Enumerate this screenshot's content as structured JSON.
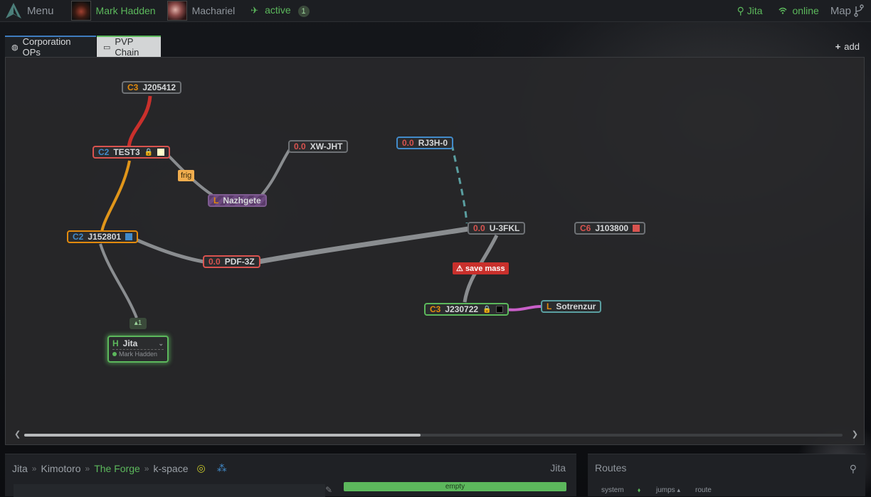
{
  "navbar": {
    "menu_label": "Menu",
    "characters": [
      {
        "name": "Mark Hadden",
        "active": true
      },
      {
        "name": "Machariel",
        "active": false
      }
    ],
    "status_label": "active",
    "status_count": "1",
    "location": "Jita",
    "connection": "online",
    "map_label": "Map"
  },
  "tabs": [
    {
      "label": "Corporation OPs",
      "icon": "globe-icon"
    },
    {
      "label": "PVP Chain",
      "icon": "desktop-icon"
    }
  ],
  "add_label": "add",
  "systems": [
    {
      "id": "j205412",
      "class": "C3",
      "name": "J205412",
      "class_color": "#e28a0d"
    },
    {
      "id": "test3",
      "class": "C2",
      "name": "TEST3",
      "class_color": "#428bca",
      "locked": true,
      "marker": "#ffffcc"
    },
    {
      "id": "xwjht",
      "class": "0.0",
      "name": "XW-JHT",
      "class_color": "#d9534f"
    },
    {
      "id": "nazhgete",
      "class": "L",
      "name": "Nazhgete",
      "class_color": "#e28a0d"
    },
    {
      "id": "rj3h0",
      "class": "0.0",
      "name": "RJ3H-0",
      "class_color": "#d9534f"
    },
    {
      "id": "j152801",
      "class": "C2",
      "name": "J152801",
      "class_color": "#428bca",
      "marker": "#428bca"
    },
    {
      "id": "pdf3z",
      "class": "0.0",
      "name": "PDF-3Z",
      "class_color": "#d9534f"
    },
    {
      "id": "u3fkl",
      "class": "0.0",
      "name": "U-3FKL",
      "class_color": "#d9534f"
    },
    {
      "id": "j103800",
      "class": "C6",
      "name": "J103800",
      "class_color": "#d9534f",
      "marker": "#d9534f"
    },
    {
      "id": "j230722",
      "class": "C3",
      "name": "J230722",
      "class_color": "#e28a0d",
      "locked": true,
      "marker": "#000000"
    },
    {
      "id": "sotrenzur",
      "class": "L",
      "name": "Sotrenzur",
      "class_color": "#e28a0d"
    }
  ],
  "home": {
    "class": "H",
    "name": "Jita",
    "pilot": "Mark Hadden",
    "user_count": "1"
  },
  "connection_labels": {
    "frig": "frig",
    "save_mass": "save mass"
  },
  "breadcrumb": {
    "system": "Jita",
    "constellation": "Kimotoro",
    "region": "The Forge",
    "space": "k-space"
  },
  "system_title": "Jita",
  "status_bar": "empty",
  "routes": {
    "title": "Routes",
    "columns": [
      "system",
      "jumps",
      "route"
    ]
  },
  "colors": {
    "green": "#5cb85c",
    "orange": "#e28a0d",
    "blue": "#428bca",
    "red": "#d9534f",
    "teal": "#5a9ea0",
    "purple": "#c95fc9"
  }
}
